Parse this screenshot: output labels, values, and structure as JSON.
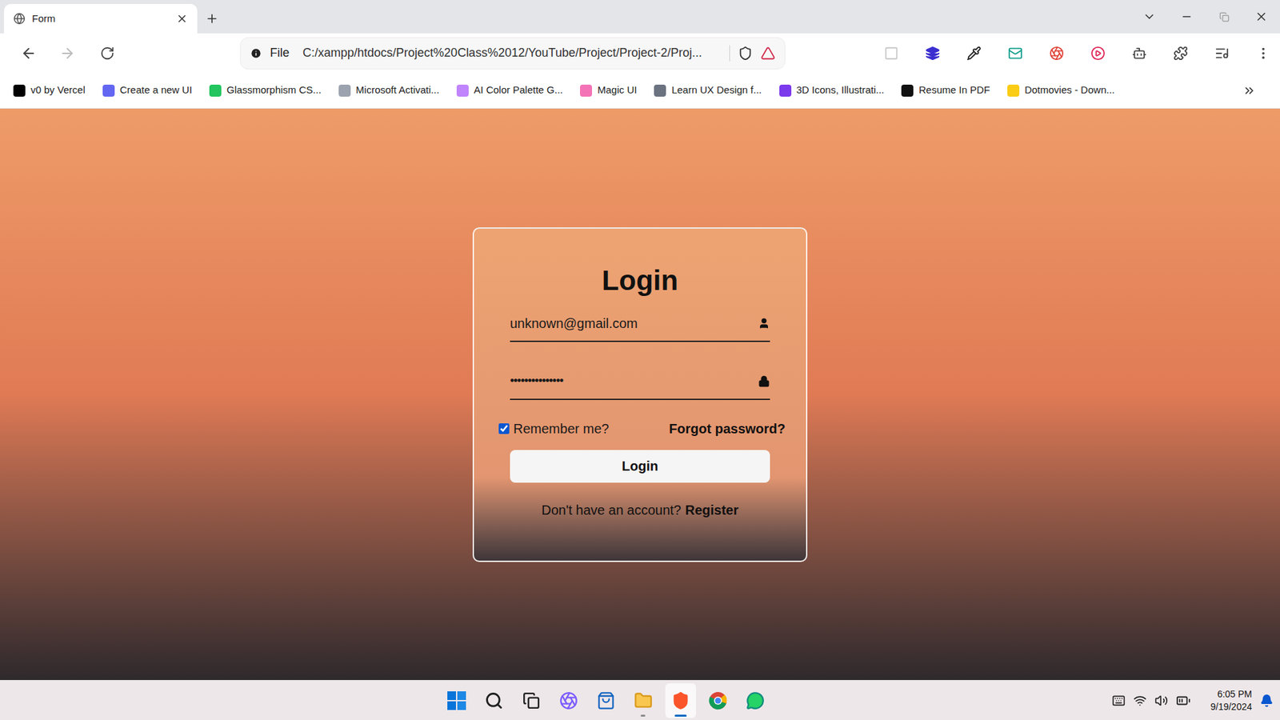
{
  "browser": {
    "tabs": [
      {
        "label": "Form",
        "selected": true
      }
    ],
    "navigation": {
      "back_enabled": true,
      "forward_enabled": false
    },
    "address": {
      "scheme_label": "File",
      "url": "C:/xampp/htdocs/Project%20Class%2012/YouTube/Project/Project-2/Proj..."
    },
    "bookmarks": [
      "v0 by Vercel",
      "Create a new UI",
      "Glassmorphism CS...",
      "Microsoft Activati...",
      "AI Color Palette G...",
      "Magic UI",
      "Learn UX Design f...",
      "3D Icons, Illustrati...",
      "Resume In PDF",
      "Dotmovies - Down..."
    ]
  },
  "login_form": {
    "title": "Login",
    "email": "unknown@gmail.com",
    "password_mask": "•••••••••••••••",
    "remember": {
      "label": "Remember me?",
      "checked": true
    },
    "forgot": "Forgot password?",
    "button": "Login",
    "register_prompt": "Don't have an account?",
    "register_link": "Register"
  },
  "taskbar": {
    "apps": [
      {
        "kind": "start",
        "running": false,
        "active": false
      },
      {
        "kind": "search",
        "running": false,
        "active": false
      },
      {
        "kind": "task-view",
        "running": false,
        "active": false
      },
      {
        "kind": "copilot",
        "running": false,
        "active": false
      },
      {
        "kind": "store",
        "running": false,
        "active": false
      },
      {
        "kind": "explorer",
        "running": true,
        "active": false
      },
      {
        "kind": "brave",
        "running": true,
        "active": true
      },
      {
        "kind": "chrome",
        "running": false,
        "active": false
      },
      {
        "kind": "whatsapp",
        "running": false,
        "active": false
      }
    ],
    "time": "6:05 PM",
    "date": "9/19/2024"
  }
}
